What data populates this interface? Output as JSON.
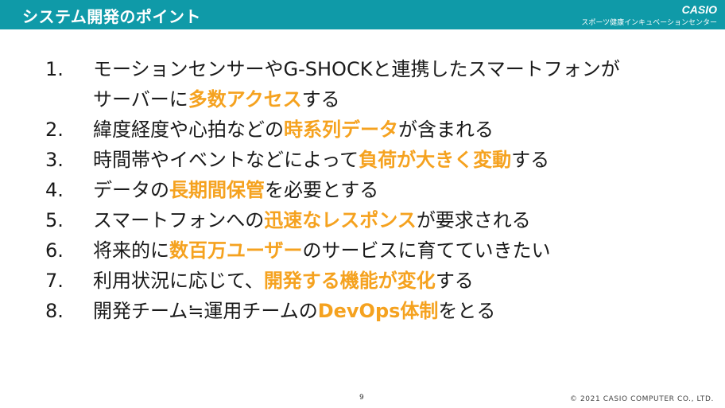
{
  "header": {
    "title": "システム開発のポイント",
    "logo": "CASIO",
    "subbrand": "スポーツ健康インキュベーションセンター",
    "bg_color": "#0f9aa8"
  },
  "highlight_color": "#f5a21f",
  "points": [
    {
      "num": "1.",
      "parts": [
        {
          "t": "モーションセンサーやG-SHOCKと連携したスマートフォンが",
          "h": false
        },
        {
          "t": "サーバーに",
          "h": false,
          "br": true
        },
        {
          "t": "多数アクセス",
          "h": true
        },
        {
          "t": "する",
          "h": false
        }
      ]
    },
    {
      "num": "2.",
      "parts": [
        {
          "t": "緯度経度や心拍などの",
          "h": false
        },
        {
          "t": "時系列データ",
          "h": true
        },
        {
          "t": "が含まれる",
          "h": false
        }
      ]
    },
    {
      "num": "3.",
      "parts": [
        {
          "t": "時間帯やイベントなどによって",
          "h": false
        },
        {
          "t": "負荷が大きく変動",
          "h": true
        },
        {
          "t": "する",
          "h": false
        }
      ]
    },
    {
      "num": "4.",
      "parts": [
        {
          "t": "データの",
          "h": false
        },
        {
          "t": "長期間保管",
          "h": true
        },
        {
          "t": "を必要とする",
          "h": false
        }
      ]
    },
    {
      "num": "5.",
      "parts": [
        {
          "t": "スマートフォンへの",
          "h": false
        },
        {
          "t": "迅速なレスポンス",
          "h": true
        },
        {
          "t": "が要求される",
          "h": false
        }
      ]
    },
    {
      "num": "6.",
      "parts": [
        {
          "t": "将来的に",
          "h": false
        },
        {
          "t": "数百万ユーザー",
          "h": true
        },
        {
          "t": "のサービスに育てていきたい",
          "h": false
        }
      ]
    },
    {
      "num": "7.",
      "parts": [
        {
          "t": "利用状況に応じて、",
          "h": false
        },
        {
          "t": "開発する機能が変化",
          "h": true
        },
        {
          "t": "する",
          "h": false
        }
      ]
    },
    {
      "num": "8.",
      "parts": [
        {
          "t": "開発チーム≒運用チームの",
          "h": false
        },
        {
          "t": "DevOps体制",
          "h": true
        },
        {
          "t": "をとる",
          "h": false
        }
      ]
    }
  ],
  "footer": {
    "page_number": "9",
    "copyright": "© 2021 CASIO COMPUTER CO., LTD."
  }
}
